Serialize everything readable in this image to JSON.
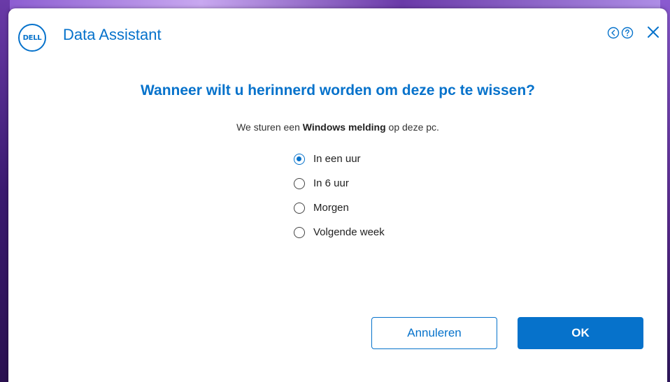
{
  "app": {
    "logo_text": "DELL",
    "title": "Data Assistant"
  },
  "titlebar": {
    "back_icon": "circle-chevron-left-icon",
    "help_icon": "circle-question-icon",
    "close_icon": "close-icon"
  },
  "main": {
    "heading": "Wanneer wilt u herinnerd worden om deze pc te wissen?",
    "subtext_before": "We sturen een ",
    "subtext_bold": "Windows melding",
    "subtext_after": " op deze pc."
  },
  "options": [
    {
      "label": "In een uur",
      "selected": true
    },
    {
      "label": "In 6 uur",
      "selected": false
    },
    {
      "label": "Morgen",
      "selected": false
    },
    {
      "label": "Volgende week",
      "selected": false
    }
  ],
  "buttons": {
    "cancel_label": "Annuleren",
    "ok_label": "OK"
  },
  "colors": {
    "accent": "#0672cb",
    "background": "#ffffff"
  }
}
